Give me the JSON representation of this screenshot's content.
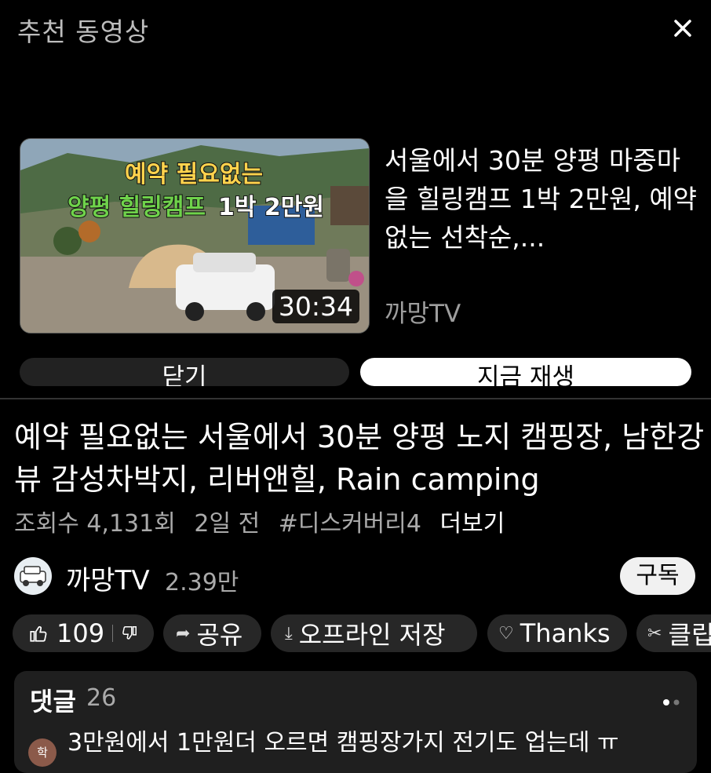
{
  "overlay": {
    "title": "추천 동영상",
    "close_icon": "close-icon",
    "suggested": {
      "thumb_line1": "예약 필요없는",
      "thumb_line2a": "양평 힐링캠프",
      "thumb_line2b": "1박 2만원",
      "duration": "30:34",
      "title": "서울에서 30분 양평 마중마을 힐링캠프 1박 2만원, 예약없는 선착순,...",
      "channel": "까망TV"
    },
    "close_label": "닫기",
    "play_now_label": "지금 재생"
  },
  "video": {
    "title": "예약 필요없는 서울에서 30분 양평 노지 캠핑장, 남한강뷰 감성차박지, 리버앤힐, Rain camping",
    "views": "조회수 4,131회",
    "age": "2일 전",
    "tag": "#디스커버리4",
    "more": "더보기"
  },
  "channel": {
    "name": "까망TV",
    "subscribers": "2.39만",
    "subscribe_label": "구독"
  },
  "actions": {
    "likes": "109",
    "share": "공유",
    "download": "오프라인 저장",
    "thanks": "Thanks",
    "clip": "클립"
  },
  "comments": {
    "label": "댓글",
    "count": "26",
    "avatar_initial": "학",
    "first": "3만원에서 1만원더 오르면 캠핑장가지 전기도 업는데 ㅠ"
  }
}
